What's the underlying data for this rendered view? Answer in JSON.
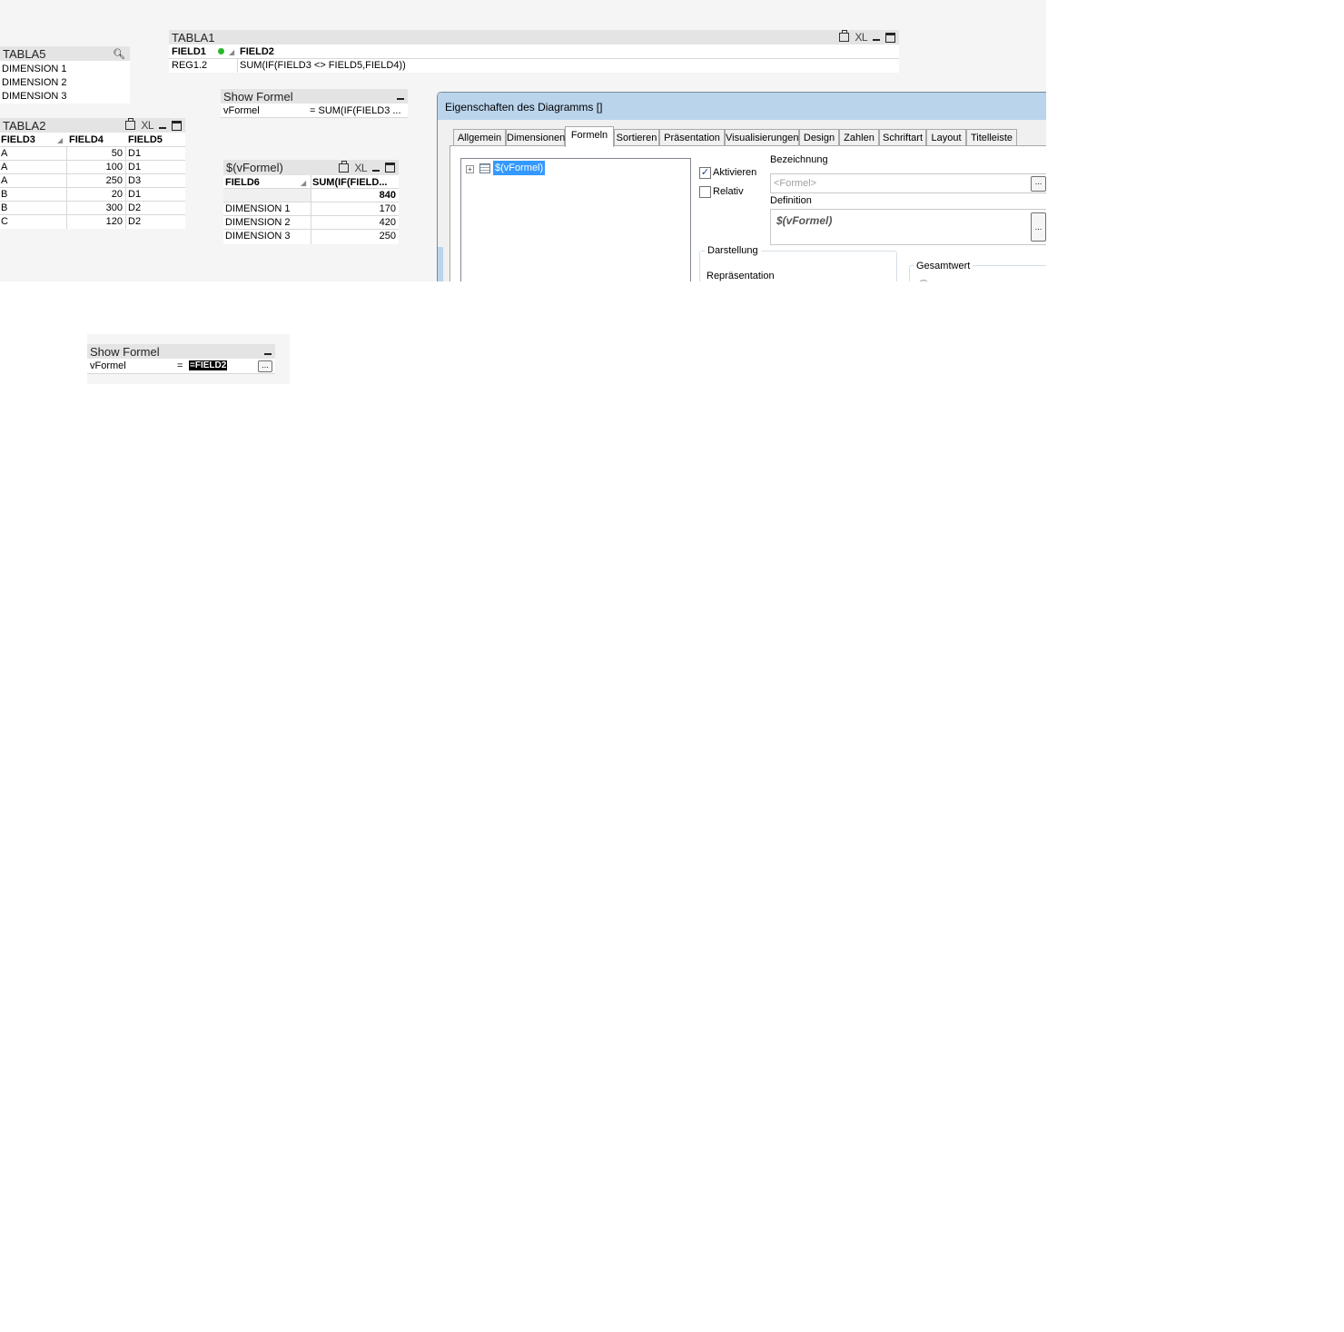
{
  "tabla5": {
    "title": "TABLA5",
    "items": [
      "DIMENSION 1",
      "DIMENSION 2",
      "DIMENSION 3"
    ]
  },
  "tabla1": {
    "title": "TABLA1",
    "xl": "XL",
    "headers": [
      "FIELD1",
      "FIELD2"
    ],
    "row": [
      "REG1.2",
      "SUM(IF(FIELD3 <> FIELD5,FIELD4))"
    ]
  },
  "show_formel_top": {
    "title": "Show Formel",
    "label": "vFormel",
    "value": "= SUM(IF(FIELD3 ..."
  },
  "tabla2": {
    "title": "TABLA2",
    "xl": "XL",
    "headers": [
      "FIELD3",
      "FIELD4",
      "FIELD5"
    ],
    "rows": [
      [
        "A",
        "50",
        "D1"
      ],
      [
        "A",
        "100",
        "D1"
      ],
      [
        "A",
        "250",
        "D3"
      ],
      [
        "B",
        "20",
        "D1"
      ],
      [
        "B",
        "300",
        "D2"
      ],
      [
        "C",
        "120",
        "D2"
      ]
    ]
  },
  "vformel_chart": {
    "title": "$(vFormel)",
    "xl": "XL",
    "headers": [
      "FIELD6",
      "SUM(IF(FIELD..."
    ],
    "total": "840",
    "rows": [
      [
        "DIMENSION 1",
        "170"
      ],
      [
        "DIMENSION 2",
        "420"
      ],
      [
        "DIMENSION 3",
        "250"
      ]
    ]
  },
  "dialog": {
    "title": "Eigenschaften des Diagramms []",
    "tabs": [
      "Allgemein",
      "Dimensionen",
      "Formeln",
      "Sortieren",
      "Präsentation",
      "Visualisierungen",
      "Design",
      "Zahlen",
      "Schriftart",
      "Layout",
      "Titelleiste"
    ],
    "active_tab": "Formeln",
    "tree_item": "$(vFormel)",
    "aktivieren": "Aktivieren",
    "relativ": "Relativ",
    "bezeichnung_label": "Bezeichnung",
    "bezeichnung_placeholder": "<Formel>",
    "definition_label": "Definition",
    "definition_value": "$(vFormel)",
    "darstellung": "Darstellung",
    "repraesentation": "Repräsentation",
    "gesamtwert": "Gesamtwert",
    "dots": "..."
  },
  "show_formel_bottom": {
    "title": "Show Formel",
    "label": "vFormel",
    "eq": "=",
    "value": "=FIELD2",
    "dots": "..."
  }
}
